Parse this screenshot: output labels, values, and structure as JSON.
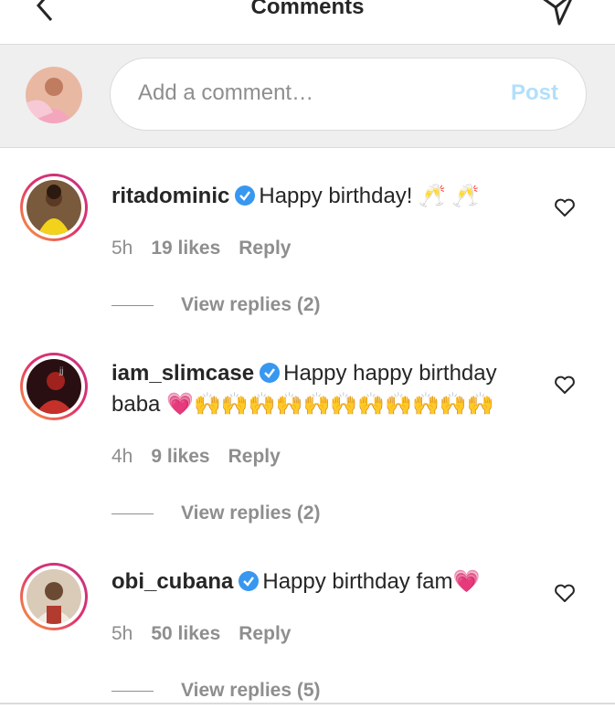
{
  "header": {
    "title": "Comments",
    "back_icon": "chevron-left-icon",
    "send_icon": "send-icon"
  },
  "comment_bar": {
    "placeholder": "Add a comment…",
    "post_label": "Post"
  },
  "comments": [
    {
      "username": "ritadominic",
      "text": "Happy birthday!",
      "emoji": "🥂 🥂",
      "time": "5h",
      "likes": "19 likes",
      "reply": "Reply",
      "view_replies": "View replies (2)"
    },
    {
      "username": "iam_slimcase",
      "text": "Happy happy birthday baba",
      "emoji": "💗🙌🙌🙌🙌🙌🙌🙌🙌🙌🙌🙌",
      "time": "4h",
      "likes": "9 likes",
      "reply": "Reply",
      "view_replies": "View replies (2)"
    },
    {
      "username": "obi_cubana",
      "text": "Happy birthday fam",
      "emoji": "💗",
      "time": "5h",
      "likes": "50 likes",
      "reply": "Reply",
      "view_replies": "View replies (5)"
    }
  ],
  "colors": {
    "verified": "#3897f0",
    "post": "#b2dffc",
    "heart": "#e84a7f"
  }
}
